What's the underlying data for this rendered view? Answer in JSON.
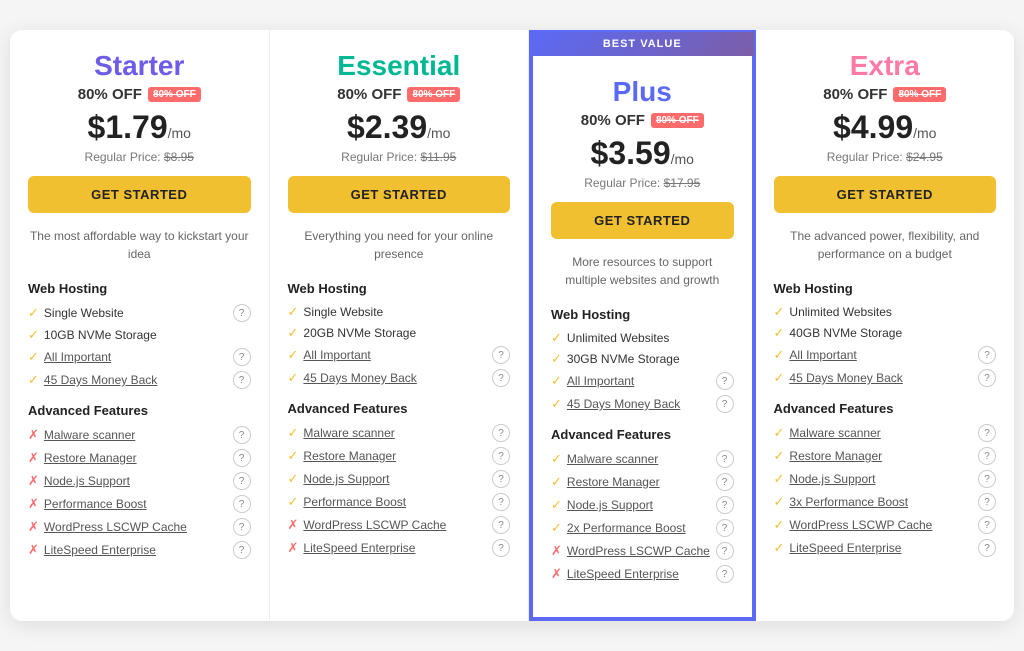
{
  "plans": [
    {
      "id": "starter",
      "name": "Starter",
      "nameClass": "starter",
      "discount": "80% OFF",
      "price": "$1.79",
      "period": "/mo",
      "regularLabel": "Regular Price:",
      "regularPrice": "$8.95",
      "cta": "GET STARTED",
      "desc": "The most affordable way to kickstart your idea",
      "featured": false,
      "bestValue": false,
      "webHostingTitle": "Web Hosting",
      "webFeatures": [
        {
          "check": true,
          "name": "Single Website",
          "info": true
        },
        {
          "check": true,
          "name": "10GB NVMe Storage",
          "info": false
        },
        {
          "check": true,
          "name": "All Important",
          "info": true,
          "underline": true
        },
        {
          "check": true,
          "name": "45 Days Money Back",
          "info": true,
          "underline": true
        }
      ],
      "advancedTitle": "Advanced Features",
      "advFeatures": [
        {
          "check": false,
          "name": "Malware scanner",
          "info": true,
          "underline": true
        },
        {
          "check": false,
          "name": "Restore Manager",
          "info": true,
          "underline": true
        },
        {
          "check": false,
          "name": "Node.js Support",
          "info": true,
          "underline": true
        },
        {
          "check": false,
          "name": "Performance Boost",
          "info": true,
          "underline": true
        },
        {
          "check": false,
          "name": "WordPress LSCWP Cache",
          "info": true,
          "underline": true
        },
        {
          "check": false,
          "name": "LiteSpeed Enterprise",
          "info": true,
          "underline": true
        }
      ]
    },
    {
      "id": "essential",
      "name": "Essential",
      "nameClass": "essential",
      "discount": "80% OFF",
      "price": "$2.39",
      "period": "/mo",
      "regularLabel": "Regular Price:",
      "regularPrice": "$11.95",
      "cta": "GET STARTED",
      "desc": "Everything you need for your online presence",
      "featured": false,
      "bestValue": false,
      "webHostingTitle": "Web Hosting",
      "webFeatures": [
        {
          "check": true,
          "name": "Single Website",
          "info": false
        },
        {
          "check": true,
          "name": "20GB NVMe Storage",
          "info": false
        },
        {
          "check": true,
          "name": "All Important",
          "info": true,
          "underline": true
        },
        {
          "check": true,
          "name": "45 Days Money Back",
          "info": true,
          "underline": true
        }
      ],
      "advancedTitle": "Advanced Features",
      "advFeatures": [
        {
          "check": true,
          "name": "Malware scanner",
          "info": true,
          "underline": true
        },
        {
          "check": true,
          "name": "Restore Manager",
          "info": true,
          "underline": true
        },
        {
          "check": true,
          "name": "Node.js Support",
          "info": true,
          "underline": true
        },
        {
          "check": true,
          "name": "Performance Boost",
          "info": true,
          "underline": true
        },
        {
          "check": false,
          "name": "WordPress LSCWP Cache",
          "info": true,
          "underline": true
        },
        {
          "check": false,
          "name": "LiteSpeed Enterprise",
          "info": true,
          "underline": true
        }
      ]
    },
    {
      "id": "plus",
      "name": "Plus",
      "nameClass": "plus",
      "discount": "80% OFF",
      "price": "$3.59",
      "period": "/mo",
      "regularLabel": "Regular Price:",
      "regularPrice": "$17.95",
      "cta": "GET STARTED",
      "desc": "More resources to support multiple websites and growth",
      "featured": true,
      "bestValue": true,
      "bestValueLabel": "BEST VALUE",
      "webHostingTitle": "Web Hosting",
      "webFeatures": [
        {
          "check": true,
          "name": "Unlimited Websites",
          "info": false
        },
        {
          "check": true,
          "name": "30GB NVMe Storage",
          "info": false
        },
        {
          "check": true,
          "name": "All Important",
          "info": true,
          "underline": true
        },
        {
          "check": true,
          "name": "45 Days Money Back",
          "info": true,
          "underline": true
        }
      ],
      "advancedTitle": "Advanced Features",
      "advFeatures": [
        {
          "check": true,
          "name": "Malware scanner",
          "info": true,
          "underline": true
        },
        {
          "check": true,
          "name": "Restore Manager",
          "info": true,
          "underline": true
        },
        {
          "check": true,
          "name": "Node.js Support",
          "info": true,
          "underline": true
        },
        {
          "check": true,
          "name": "2x Performance Boost",
          "info": true,
          "underline": true
        },
        {
          "check": false,
          "name": "WordPress LSCWP Cache",
          "info": true,
          "underline": true
        },
        {
          "check": false,
          "name": "LiteSpeed Enterprise",
          "info": true,
          "underline": true
        }
      ]
    },
    {
      "id": "extra",
      "name": "Extra",
      "nameClass": "extra",
      "discount": "80% OFF",
      "price": "$4.99",
      "period": "/mo",
      "regularLabel": "Regular Price:",
      "regularPrice": "$24.95",
      "cta": "GET STARTED",
      "desc": "The advanced power, flexibility, and performance on a budget",
      "featured": false,
      "bestValue": false,
      "webHostingTitle": "Web Hosting",
      "webFeatures": [
        {
          "check": true,
          "name": "Unlimited Websites",
          "info": false
        },
        {
          "check": true,
          "name": "40GB NVMe Storage",
          "info": false
        },
        {
          "check": true,
          "name": "All Important",
          "info": true,
          "underline": true
        },
        {
          "check": true,
          "name": "45 Days Money Back",
          "info": true,
          "underline": true
        }
      ],
      "advancedTitle": "Advanced Features",
      "advFeatures": [
        {
          "check": true,
          "name": "Malware scanner",
          "info": true,
          "underline": true
        },
        {
          "check": true,
          "name": "Restore Manager",
          "info": true,
          "underline": true
        },
        {
          "check": true,
          "name": "Node.js Support",
          "info": true,
          "underline": true
        },
        {
          "check": true,
          "name": "3x Performance Boost",
          "info": true,
          "underline": true
        },
        {
          "check": true,
          "name": "WordPress LSCWP Cache",
          "info": true,
          "underline": true
        },
        {
          "check": true,
          "name": "LiteSpeed Enterprise",
          "info": true,
          "underline": true
        }
      ]
    }
  ]
}
